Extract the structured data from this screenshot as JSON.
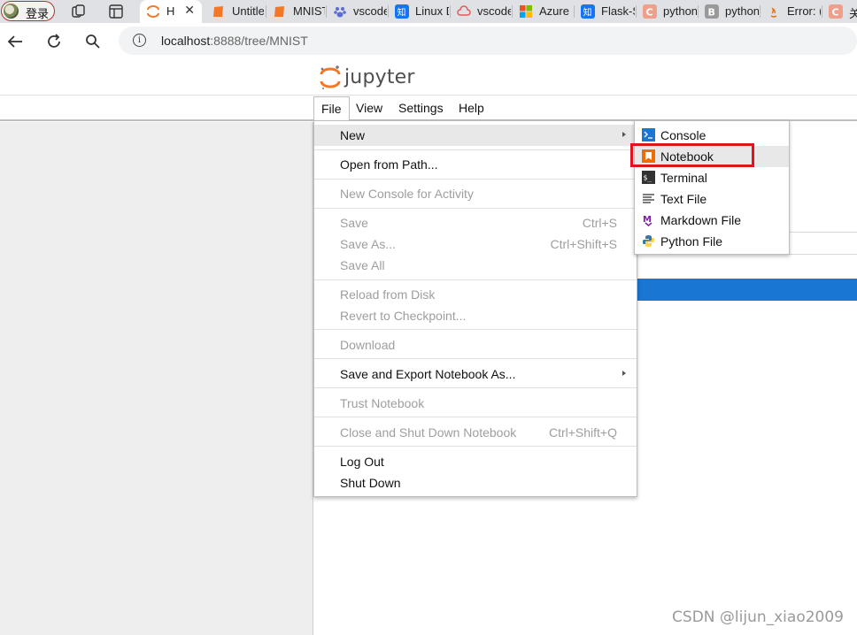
{
  "browser": {
    "profile_label": "登录",
    "tabs": [
      {
        "title": "H",
        "active": true,
        "favicon": "jupyter-icon"
      },
      {
        "title": "Untitle",
        "favicon": "jupyter-notebook-icon"
      },
      {
        "title": "MNIST",
        "favicon": "jupyter-notebook-icon"
      },
      {
        "title": "vscode",
        "favicon": "baidu-paw-icon"
      },
      {
        "title": "Linux D",
        "favicon": "zhihu-icon"
      },
      {
        "title": "vscode",
        "favicon": "cloud-icon"
      },
      {
        "title": "Azure",
        "favicon": "microsoft-icon"
      },
      {
        "title": "Flask-S",
        "favicon": "zhihu-icon"
      },
      {
        "title": "python",
        "favicon": "csdn-icon"
      },
      {
        "title": "python",
        "favicon": "blog-icon"
      },
      {
        "title": "Error: (",
        "favicon": "java-icon"
      },
      {
        "title": "关",
        "favicon": "csdn-icon"
      }
    ],
    "url_host": "localhost",
    "url_path": ":8888/tree/MNIST"
  },
  "jupyter": {
    "logo_text": "jupyter",
    "menus": [
      "File",
      "View",
      "Settings",
      "Help"
    ],
    "file_menu": {
      "new": "New",
      "open_from_path": "Open from Path...",
      "new_console": "New Console for Activity",
      "save": "Save",
      "save_shortcut": "Ctrl+S",
      "save_as": "Save As...",
      "save_as_shortcut": "Ctrl+Shift+S",
      "save_all": "Save All",
      "reload": "Reload from Disk",
      "revert": "Revert to Checkpoint...",
      "download": "Download",
      "save_export": "Save and Export Notebook As...",
      "trust": "Trust Notebook",
      "close_shutdown": "Close and Shut Down Notebook",
      "close_shutdown_shortcut": "Ctrl+Shift+Q",
      "logout": "Log Out",
      "shutdown": "Shut Down"
    },
    "new_menu": {
      "console": "Console",
      "notebook": "Notebook",
      "terminal": "Terminal",
      "text_file": "Text File",
      "markdown_file": "Markdown File",
      "python_file": "Python File"
    }
  },
  "watermark": "CSDN @lijun_xiao2009",
  "colors": {
    "jupyter_orange": "#f37726",
    "highlight_red": "#e0131f",
    "selection_blue": "#1976d2"
  }
}
